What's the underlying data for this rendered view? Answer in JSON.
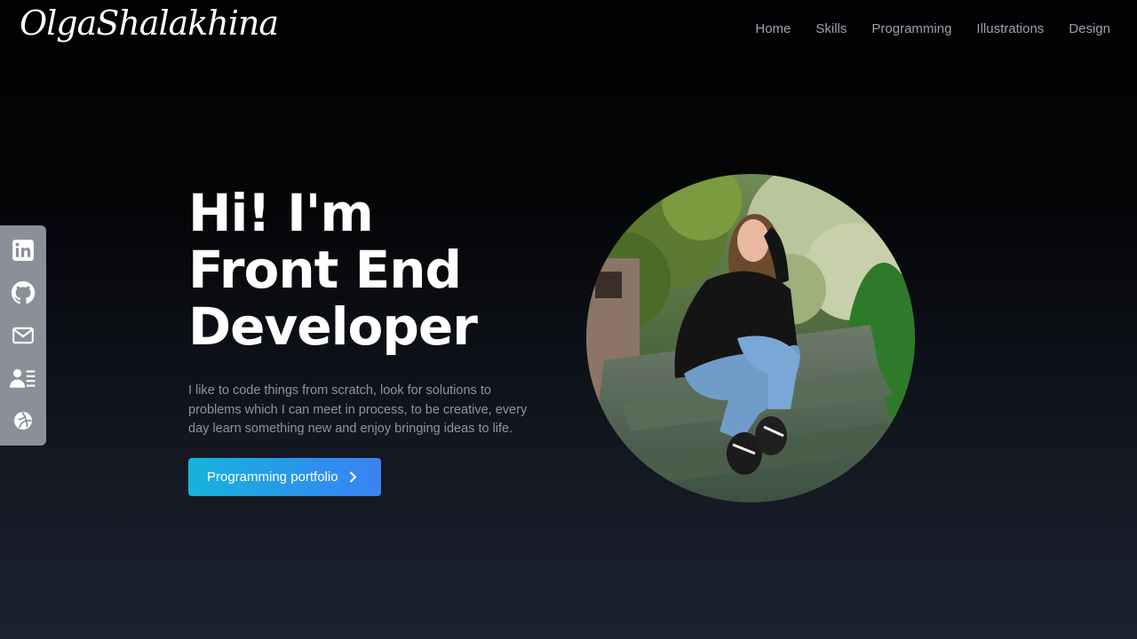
{
  "header": {
    "logo": "OlgaShalakhina",
    "nav": [
      "Home",
      "Skills",
      "Programming",
      "Illustrations",
      "Design"
    ]
  },
  "side_links": [
    {
      "icon": "linkedin-icon"
    },
    {
      "icon": "github-icon"
    },
    {
      "icon": "mail-icon"
    },
    {
      "icon": "resume-icon"
    },
    {
      "icon": "dribbble-icon"
    }
  ],
  "hero": {
    "title_lines": [
      "Hi! I'm",
      "Front End",
      "Developer"
    ],
    "description": "I like to code things from scratch, look for solutions to problems which I can meet in process, to be creative, every day learn something new and enjoy bringing ideas to life.",
    "cta_label": "Programming portfolio",
    "cta_icon": "chevron-right-icon"
  },
  "colors": {
    "background_top": "#020203",
    "background_bottom": "#1b2130",
    "nav_text": "#9aa1ad",
    "body_text": "#8d94a2",
    "side_panel": "#8a8f98",
    "cta_start": "#16b3dc",
    "cta_end": "#3b82f2"
  }
}
